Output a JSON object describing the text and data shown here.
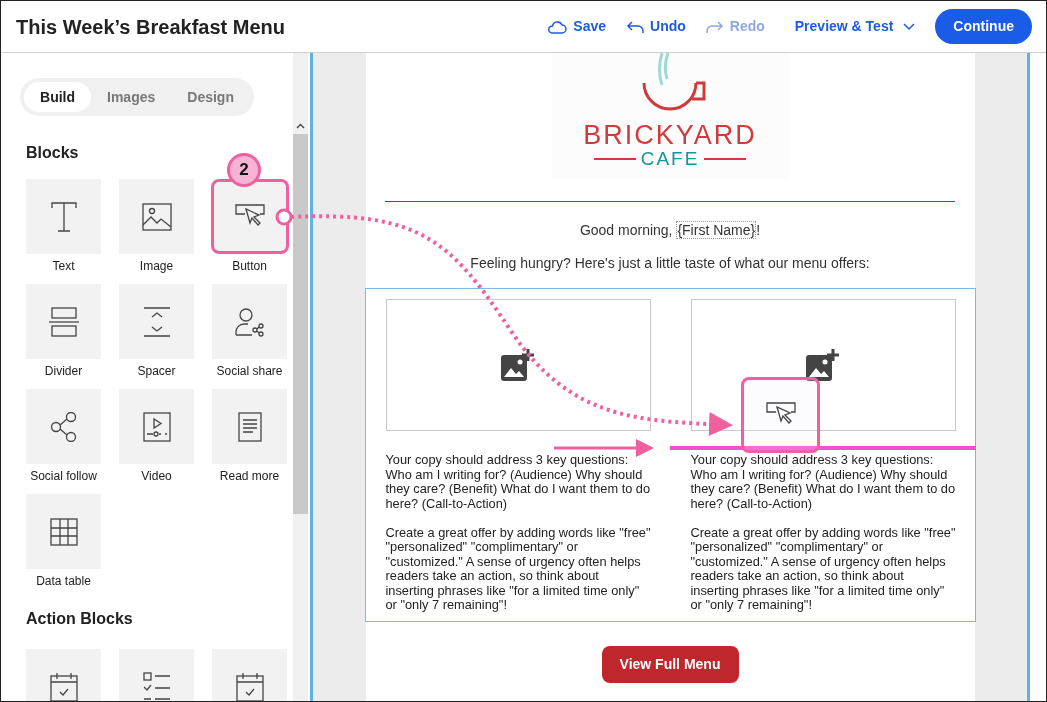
{
  "header": {
    "title": "This Week’s Breakfast Menu",
    "actions": [
      {
        "label": "Save",
        "disabled": false
      },
      {
        "label": "Undo",
        "disabled": false
      },
      {
        "label": "Redo",
        "disabled": true
      }
    ],
    "preview": "Preview & Test",
    "continue": "Continue"
  },
  "sidebar": {
    "tabs": [
      {
        "label": "Build",
        "selected": true
      },
      {
        "label": "Images",
        "selected": false
      },
      {
        "label": "Design",
        "selected": false
      }
    ],
    "sections": [
      {
        "title": "Blocks",
        "tiles": [
          {
            "label": "Text",
            "highlighted": false
          },
          {
            "label": "Image",
            "highlighted": false
          },
          {
            "label": "Button",
            "highlighted": true
          },
          {
            "label": "Divider",
            "highlighted": false
          },
          {
            "label": "Spacer",
            "highlighted": false
          },
          {
            "label": "Social share",
            "highlighted": false
          },
          {
            "label": "Social follow",
            "highlighted": false
          },
          {
            "label": "Video",
            "highlighted": false
          },
          {
            "label": "Read more",
            "highlighted": false
          },
          {
            "label": "Data table",
            "highlighted": false
          }
        ]
      },
      {
        "title": "Action Blocks",
        "tiles": [
          {
            "highlighted": false
          },
          {
            "highlighted": false
          },
          {
            "highlighted": false
          }
        ]
      }
    ]
  },
  "step_badge": "2",
  "email": {
    "logo": {
      "name": "BRICKYARD",
      "sub": "CAFE"
    },
    "greeting": "Good morning, ",
    "merge_field": "{First Name}",
    "greeting_end": "!",
    "intro": "Feeling hungry? Here's just a little taste of what our menu offers:",
    "columns": [
      {
        "paragraphs": [
          "Your copy should address 3 key questions: Who am I writing for? (Audience) Why should they care? (Benefit) What do I want them to do here? (Call-to-Action)",
          "Create a great offer by adding words like \"free\" \"personalized\" \"complimentary\" or \"customized.\" A sense of urgency often helps readers take an action, so think about inserting phrases like \"for a limited time only\" or \"only 7 remaining\"!"
        ]
      },
      {
        "paragraphs": [
          "Your copy should address 3 key questions: Who am I writing for? (Audience) Why should they care? (Benefit) What do I want them to do here? (Call-to-Action)",
          "Create a great offer by adding words like \"free\" \"personalized\" \"complimentary\" or \"customized.\" A sense of urgency often helps readers take an action, so think about inserting phrases like \"for a limited time only\" or \"only 7 remaining\"!"
        ]
      }
    ],
    "cta": "View Full Menu"
  }
}
